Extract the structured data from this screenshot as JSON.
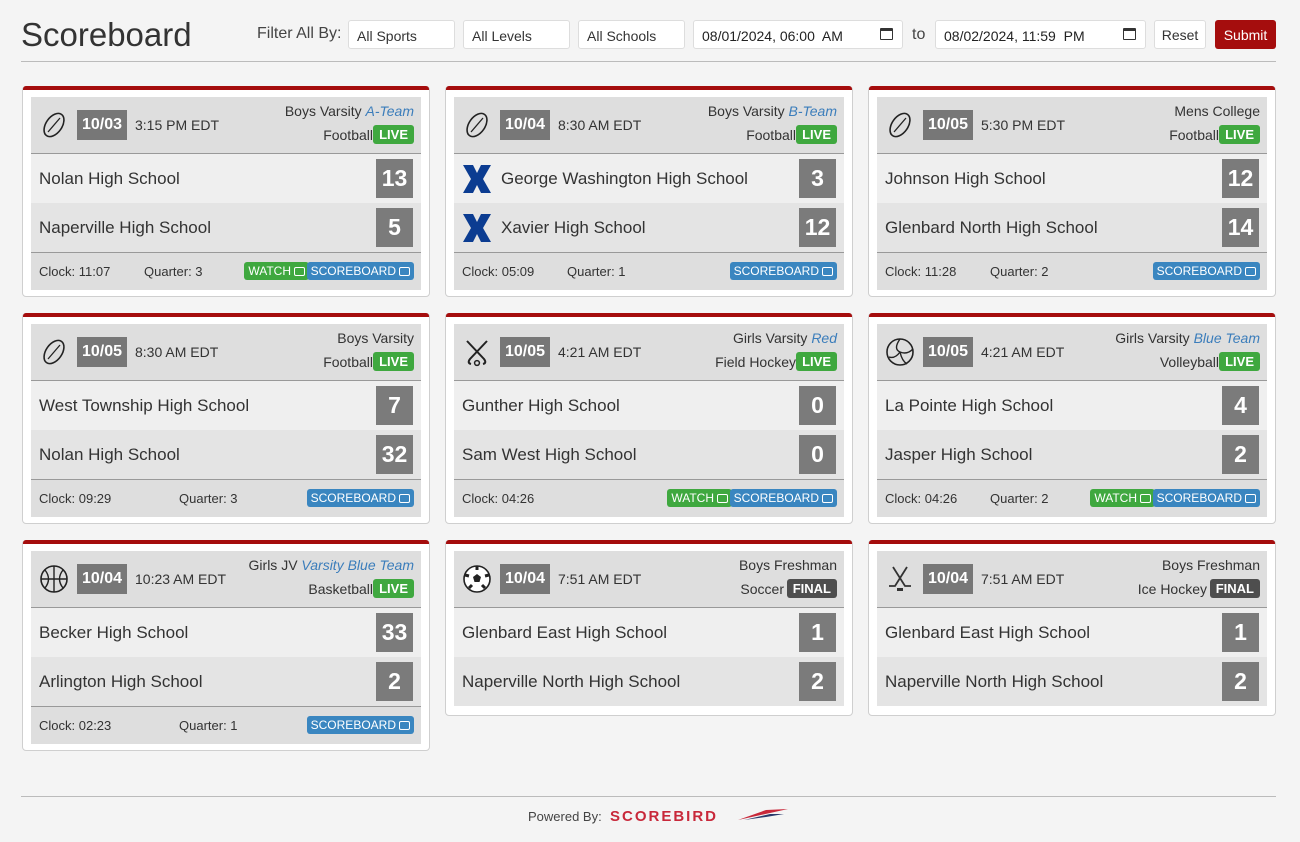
{
  "header": {
    "title": "Scoreboard",
    "filter_label": "Filter All By:",
    "sports": "All Sports",
    "levels": "All Levels",
    "schools": "All Schools",
    "from": "08/01/2024, 06:00  AM",
    "to_label": "to",
    "to": "08/02/2024, 11:59  PM",
    "reset": "Reset",
    "submit": "Submit"
  },
  "games": [
    {
      "icon": "football-icon",
      "date": "10/03",
      "time": "3:15 PM EDT",
      "level": "Boys Varsity ",
      "team": "A-Team",
      "sport": "Football",
      "status": "LIVE",
      "home": "Nolan High School",
      "home_score": "13",
      "away": "Naperville High School",
      "away_score": "5",
      "clock": "Clock: 11:07",
      "quarter": "Quarter: 3",
      "watch": "WATCH",
      "scoreboard": "SCOREBOARD",
      "logos": false,
      "has_footer": true
    },
    {
      "icon": "football-icon",
      "date": "10/04",
      "time": "8:30 AM EDT",
      "level": "Boys Varsity ",
      "team": "B-Team",
      "sport": "Football",
      "status": "LIVE",
      "home": "George Washington High School",
      "home_score": "3",
      "away": "Xavier High School",
      "away_score": "12",
      "clock": "Clock: 05:09",
      "quarter": "Quarter: 1",
      "watch": "",
      "scoreboard": "SCOREBOARD",
      "logos": true,
      "has_footer": true
    },
    {
      "icon": "football-icon",
      "date": "10/05",
      "time": "5:30 PM EDT",
      "level": "Mens College",
      "team": "",
      "sport": "Football",
      "status": "LIVE",
      "home": "Johnson High School",
      "home_score": "12",
      "away": "Glenbard North High School",
      "away_score": "14",
      "clock": "Clock: 11:28",
      "quarter": "Quarter: 2",
      "watch": "",
      "scoreboard": "SCOREBOARD",
      "logos": false,
      "has_footer": true
    },
    {
      "icon": "football-icon",
      "date": "10/05",
      "time": "8:30 AM EDT",
      "level": "Boys Varsity",
      "team": "",
      "sport": "Football",
      "status": "LIVE",
      "home": "West Township High School",
      "home_score": "7",
      "away": "Nolan High School",
      "away_score": "32",
      "clock": "Clock: 09:29",
      "quarter": "Quarter: 3",
      "watch": "",
      "scoreboard": "SCOREBOARD",
      "logos": false,
      "has_footer": true
    },
    {
      "icon": "field-hockey-icon",
      "date": "10/05",
      "time": "4:21 AM EDT",
      "level": "Girls Varsity ",
      "team": "Red",
      "sport": "Field Hockey",
      "status": "LIVE",
      "home": "Gunther High School",
      "home_score": "0",
      "away": "Sam West High School",
      "away_score": "0",
      "clock": "Clock: 04:26",
      "quarter": "",
      "watch": "WATCH",
      "scoreboard": "SCOREBOARD",
      "logos": false,
      "has_footer": true
    },
    {
      "icon": "volleyball-icon",
      "date": "10/05",
      "time": "4:21 AM EDT",
      "level": "Girls Varsity ",
      "team": "Blue Team",
      "sport": "Volleyball",
      "status": "LIVE",
      "home": "La Pointe High School",
      "home_score": "4",
      "away": "Jasper High School",
      "away_score": "2",
      "clock": "Clock: 04:26",
      "quarter": "Quarter: 2",
      "watch": "WATCH",
      "scoreboard": "SCOREBOARD",
      "logos": false,
      "has_footer": true
    },
    {
      "icon": "basketball-icon",
      "date": "10/04",
      "time": "10:23 AM EDT",
      "level": "Girls JV ",
      "team": "Varsity Blue Team",
      "sport": "Basketball",
      "status": "LIVE",
      "home": "Becker High School",
      "home_score": "33",
      "away": "Arlington High School",
      "away_score": "2",
      "clock": "Clock: 02:23",
      "quarter": "Quarter: 1",
      "watch": "",
      "scoreboard": "SCOREBOARD",
      "logos": false,
      "has_footer": true
    },
    {
      "icon": "soccer-icon",
      "date": "10/04",
      "time": "7:51 AM EDT",
      "level": "Boys Freshman",
      "team": "",
      "sport": "Soccer",
      "status": "FINAL",
      "home": "Glenbard East High School",
      "home_score": "1",
      "away": "Naperville North High School",
      "away_score": "2",
      "clock": "",
      "quarter": "",
      "watch": "",
      "scoreboard": "",
      "logos": false,
      "has_footer": false
    },
    {
      "icon": "ice-hockey-icon",
      "date": "10/04",
      "time": "7:51 AM EDT",
      "level": "Boys Freshman",
      "team": "",
      "sport": "Ice Hockey",
      "status": "FINAL",
      "home": "Glenbard East High School",
      "home_score": "1",
      "away": "Naperville North High School",
      "away_score": "2",
      "clock": "",
      "quarter": "",
      "watch": "",
      "scoreboard": "",
      "logos": false,
      "has_footer": false
    }
  ],
  "footer": {
    "powered_by": "Powered By:",
    "brand": "SCOREBIRD"
  },
  "colors": {
    "accent": "#a50d0d",
    "live": "#3fa83f",
    "final": "#4e4e4e",
    "scoreboard": "#3a86c0",
    "team_link": "#3b7dbb"
  }
}
